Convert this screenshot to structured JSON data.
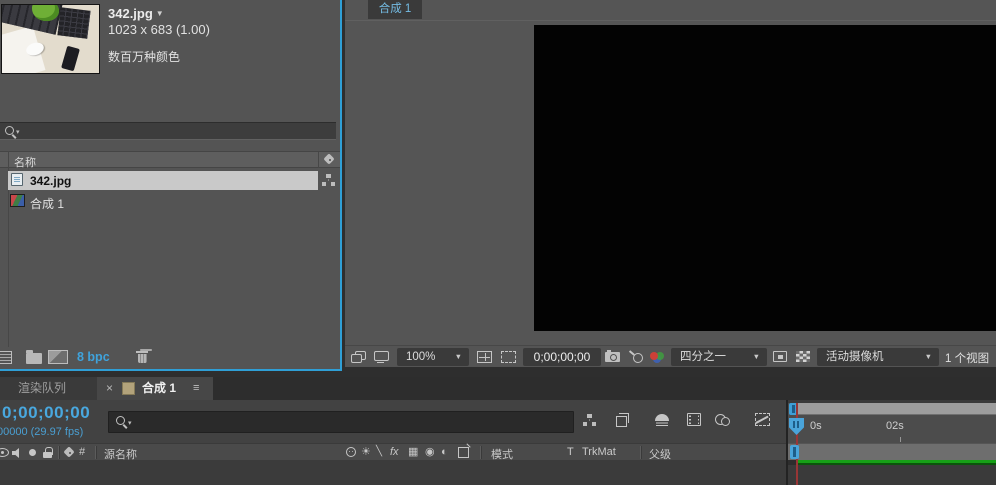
{
  "colors": {
    "accent_cyan": "#2f9fd6",
    "timecode_cyan": "#49a8df",
    "selection_bg": "#c9c9c9",
    "cached_frames_green": "#17a017",
    "cti_red": "#993636",
    "comp_swatch_tan": "#b3a37b"
  },
  "project": {
    "preview": {
      "filename": "342.jpg",
      "dimensions": "1023 x 683 (1.00)",
      "color_depth": "数百万种颜色"
    },
    "search": {
      "placeholder": ""
    },
    "list": {
      "name_column": "名称",
      "items": [
        {
          "name": "342.jpg",
          "type": "footage",
          "selected": true
        },
        {
          "name": "合成 1",
          "type": "composition",
          "selected": false
        }
      ]
    },
    "footer": {
      "bit_depth": "8 bpc"
    }
  },
  "viewer": {
    "tab_label": "合成 1",
    "zoom_level": "100%",
    "timecode": "0;00;00;00",
    "resolution": "四分之一",
    "camera_view": "活动摄像机",
    "view_count": "1 个视图"
  },
  "timeline": {
    "render_queue_tab": "渲染队列",
    "comp_tab": "合成 1",
    "timecode": "0;00;00;00",
    "frame_info": "00000 (29.97 fps)",
    "ruler": {
      "zero": "0s",
      "two": "02s"
    },
    "columns": {
      "hash": "#",
      "source_name": "源名称",
      "mode": "模式",
      "t_label": "T",
      "trkmat": "TrkMat",
      "parent": "父级"
    }
  },
  "glyphs": {
    "dropdown": "▼",
    "search_caret": "▾",
    "close": "×",
    "panel_menu": "≡",
    "sun": "☀",
    "quality_slash": "╲",
    "fx": "fx",
    "frame_blend": "▦",
    "motion_blur": "◉",
    "adjustment": "◐"
  }
}
